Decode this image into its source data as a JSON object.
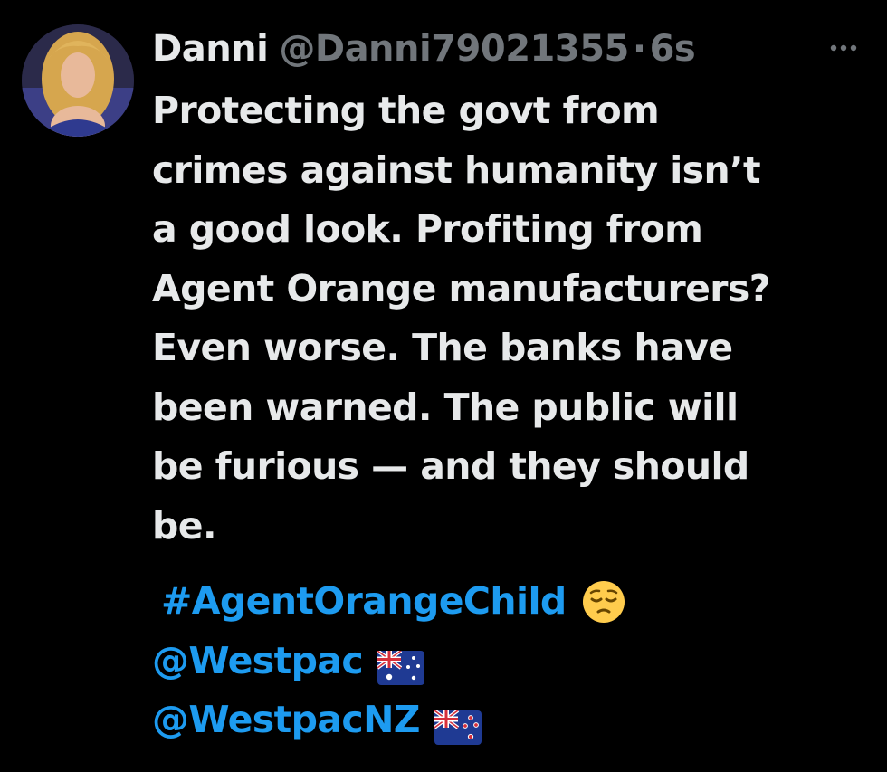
{
  "tweet": {
    "author": {
      "display_name": "Danni",
      "handle": "@Danni79021355",
      "separator": "·",
      "time": "6s"
    },
    "more_icon": "more-horizontal-icon",
    "text_lines": [
      "Protecting the govt from",
      "crimes against humanity isn’t",
      "a good look. Profiting from",
      "Agent Orange manufacturers?",
      "Even worse. The banks have",
      "been warned. The public will",
      "be furious — and they should",
      "be."
    ],
    "hashtag": "#AgentOrangeChild",
    "hashtag_emoji": "pensive-face-emoji",
    "mentions": [
      {
        "text": "@Westpac",
        "flag": "australia-flag-icon"
      },
      {
        "text": "@WestpacNZ",
        "flag": "new-zealand-flag-icon"
      }
    ],
    "colors": {
      "background": "#000000",
      "text": "#e7e9ea",
      "secondary": "#71767b",
      "link": "#1d9bf0"
    }
  }
}
